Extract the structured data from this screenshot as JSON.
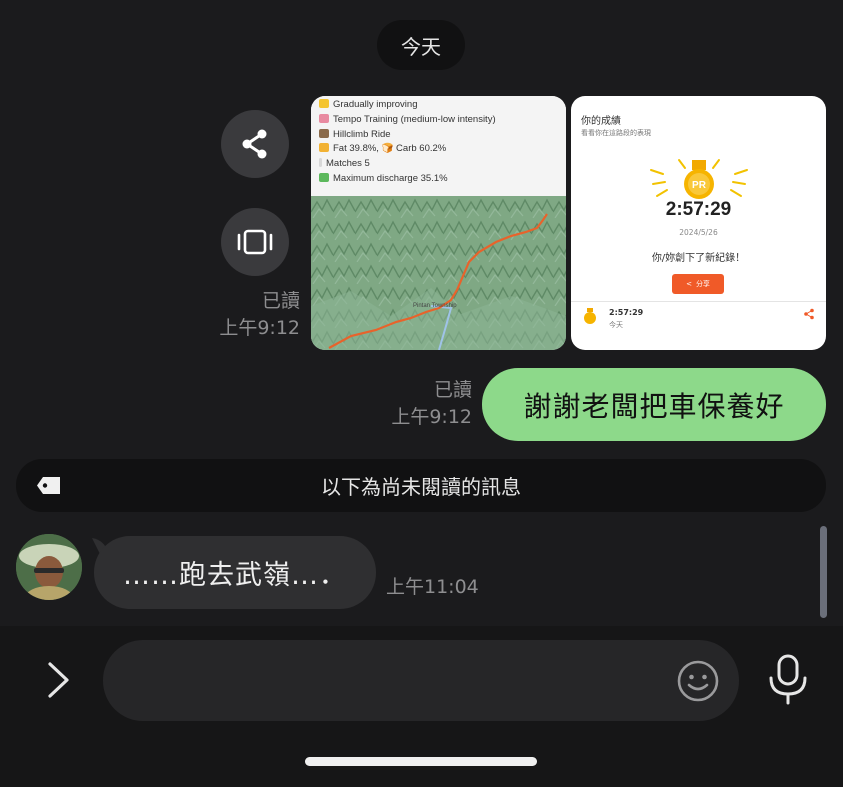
{
  "date_separator": "今天",
  "image_message": {
    "read_status": "已讀",
    "time": "上午9:12",
    "stats_card": {
      "lines": [
        "Gradually improving",
        "Tempo Training (medium-low intensity)",
        "Hillclimb Ride",
        "Fat 39.8%, 🍞 Carb 60.2%",
        "Matches 5",
        "Maximum discharge 35.1%"
      ],
      "map_label": "Pintan Township"
    },
    "pr_card": {
      "title": "你的成績",
      "subtitle": "看看你在這路段的表現",
      "badge": "PR",
      "time": "2:57:29",
      "date": "2024/5/26",
      "message": "你/妳創下了新紀錄！",
      "share_label": "分享",
      "footer_time": "2:57:29",
      "footer_day": "今天"
    }
  },
  "sent_message": {
    "read_status": "已讀",
    "time": "上午9:12",
    "text": "謝謝老闆把車保養好"
  },
  "unread_divider": "以下為尚未閱讀的訊息",
  "received_message": {
    "text": "……跑去武嶺…．",
    "time": "上午11:04"
  },
  "composer": {
    "placeholder": ""
  },
  "colors": {
    "background": "#1b1b1d",
    "sent_bubble": "#8dd98a",
    "received_bubble": "#2f2f31",
    "pr_orange": "#f05a28"
  }
}
